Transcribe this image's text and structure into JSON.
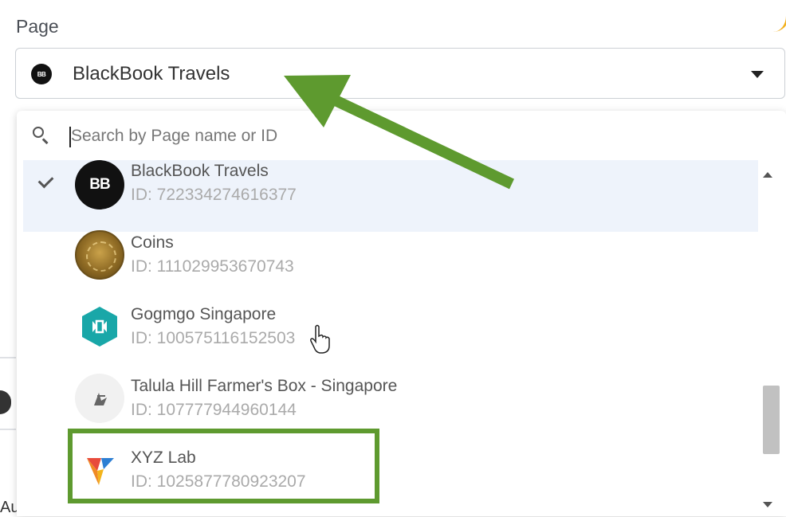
{
  "page_label": "Page",
  "selector": {
    "avatar_text": "BB",
    "value": "BlackBook Travels"
  },
  "search": {
    "placeholder": "Search by Page name or ID"
  },
  "pages": [
    {
      "name": "BlackBook Travels",
      "id": "ID: 722334274616377",
      "avatar": "BB",
      "selected": true
    },
    {
      "name": "Coins",
      "id": "ID: 111029953670743",
      "selected": false
    },
    {
      "name": "Gogmgo Singapore",
      "id": "ID: 100575116152503",
      "selected": false
    },
    {
      "name": "Talula Hill Farmer's Box - Singapore",
      "id": "ID: 107777944960144",
      "selected": false
    },
    {
      "name": "XYZ Lab",
      "id": "ID: 1025877780923207",
      "selected": false
    }
  ],
  "left_partial_text": "Au",
  "colors": {
    "highlight_green": "#5e9a2f",
    "selected_row_bg": "#eef3fb",
    "accent_yellow": "#f2b01e"
  }
}
